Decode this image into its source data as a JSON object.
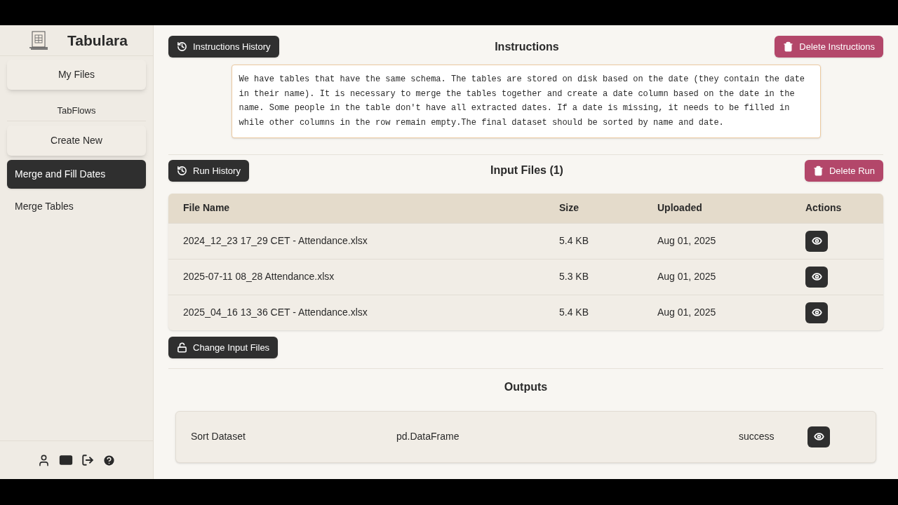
{
  "app": {
    "name": "Tabulara"
  },
  "sidebar": {
    "my_files": "My Files",
    "section_label": "TabFlows",
    "create_new": "Create New",
    "flows": [
      {
        "label": "Merge and Fill Dates",
        "selected": true
      },
      {
        "label": "Merge Tables",
        "selected": false
      }
    ]
  },
  "instructions": {
    "history_button": "Instructions History",
    "title": "Instructions",
    "delete_button": "Delete Instructions",
    "text": "We have tables that have the same schema. The tables are stored on disk based on the date (they contain the date in their name). It is necessary to merge the tables together and create a date column based on the date in the name. Some people in the table don't have all extracted dates. If a date is missing, it needs to be filled in while other columns in the row remain empty.The final dataset should be sorted by name and date."
  },
  "input_files": {
    "history_button": "Run History",
    "title": "Input Files (1)",
    "delete_button": "Delete Run",
    "columns": [
      "File Name",
      "Size",
      "Uploaded",
      "Actions"
    ],
    "rows": [
      {
        "name": "2024_12_23 17_29 CET - Attendance.xlsx",
        "size": "5.4 KB",
        "uploaded": "Aug 01, 2025"
      },
      {
        "name": "2025-07-11 08_28 Attendance.xlsx",
        "size": "5.3 KB",
        "uploaded": "Aug 01, 2025"
      },
      {
        "name": "2025_04_16 13_36 CET - Attendance.xlsx",
        "size": "5.4 KB",
        "uploaded": "Aug 01, 2025"
      }
    ],
    "change_button": "Change Input Files"
  },
  "outputs": {
    "title": "Outputs",
    "rows": [
      {
        "name": "Sort Dataset",
        "type": "pd.DataFrame",
        "status": "success"
      }
    ]
  }
}
